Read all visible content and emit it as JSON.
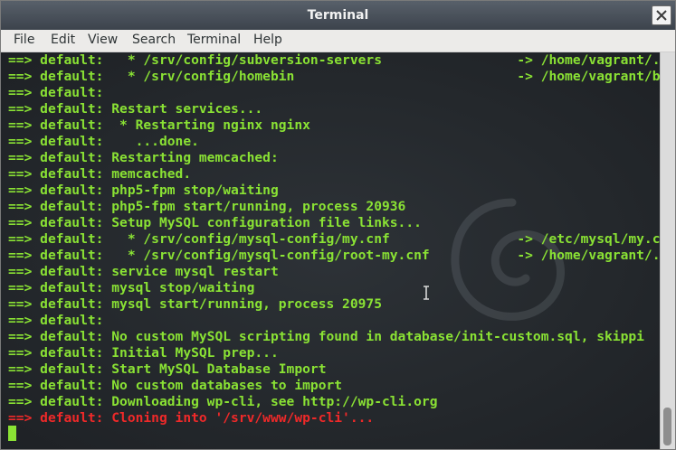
{
  "window": {
    "title": "Terminal"
  },
  "menu": [
    "File",
    "Edit",
    "View",
    "Search",
    "Terminal",
    "Help"
  ],
  "terminal": {
    "lines": [
      {
        "prefix": "==>",
        "host": "default:",
        "text": "  * /srv/config/subversion-servers                 -> /home/vagrant/.",
        "error": false
      },
      {
        "prefix": "==>",
        "host": "default:",
        "text": "  * /srv/config/homebin                            -> /home/vagrant/b",
        "error": false
      },
      {
        "prefix": "==>",
        "host": "default:",
        "text": "",
        "error": false
      },
      {
        "prefix": "==>",
        "host": "default:",
        "text": "Restart services...",
        "error": false
      },
      {
        "prefix": "==>",
        "host": "default:",
        "text": " * Restarting nginx nginx",
        "error": false
      },
      {
        "prefix": "==>",
        "host": "default:",
        "text": "   ...done.",
        "error": false
      },
      {
        "prefix": "==>",
        "host": "default:",
        "text": "Restarting memcached:",
        "error": false
      },
      {
        "prefix": "==>",
        "host": "default:",
        "text": "memcached.",
        "error": false
      },
      {
        "prefix": "==>",
        "host": "default:",
        "text": "php5-fpm stop/waiting",
        "error": false
      },
      {
        "prefix": "==>",
        "host": "default:",
        "text": "php5-fpm start/running, process 20936",
        "error": false
      },
      {
        "prefix": "==>",
        "host": "default:",
        "text": "Setup MySQL configuration file links...",
        "error": false
      },
      {
        "prefix": "==>",
        "host": "default:",
        "text": "  * /srv/config/mysql-config/my.cnf                -> /etc/mysql/my.c",
        "error": false
      },
      {
        "prefix": "==>",
        "host": "default:",
        "text": "  * /srv/config/mysql-config/root-my.cnf           -> /home/vagrant/.",
        "error": false
      },
      {
        "prefix": "==>",
        "host": "default:",
        "text": "service mysql restart",
        "error": false
      },
      {
        "prefix": "==>",
        "host": "default:",
        "text": "mysql stop/waiting",
        "error": false
      },
      {
        "prefix": "==>",
        "host": "default:",
        "text": "mysql start/running, process 20975",
        "error": false
      },
      {
        "prefix": "==>",
        "host": "default:",
        "text": "",
        "error": false
      },
      {
        "prefix": "==>",
        "host": "default:",
        "text": "No custom MySQL scripting found in database/init-custom.sql, skippi",
        "error": false
      },
      {
        "prefix": "==>",
        "host": "default:",
        "text": "Initial MySQL prep...",
        "error": false
      },
      {
        "prefix": "==>",
        "host": "default:",
        "text": "Start MySQL Database Import",
        "error": false
      },
      {
        "prefix": "==>",
        "host": "default:",
        "text": "No custom databases to import",
        "error": false
      },
      {
        "prefix": "==>",
        "host": "default:",
        "text": "Downloading wp-cli, see http://wp-cli.org",
        "error": false
      },
      {
        "prefix": "==>",
        "host": "default:",
        "text": "Cloning into '/srv/www/wp-cli'...",
        "error": true
      }
    ]
  },
  "colors": {
    "prompt_green": "#8ae234",
    "error_red": "#ef2929",
    "terminal_bg": "#24282c"
  }
}
